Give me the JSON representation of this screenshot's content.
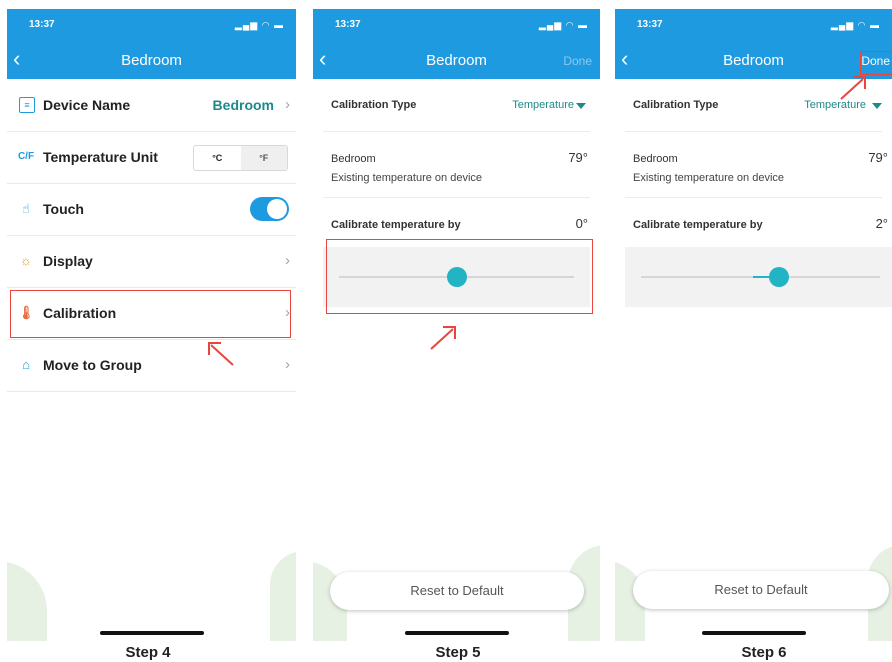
{
  "status": {
    "time": "13:37"
  },
  "navbar": {
    "title": "Bedroom",
    "done_label": "Done"
  },
  "step4": {
    "rows": [
      {
        "icon": "device-name-icon",
        "label": "Device Name",
        "value": "Bedroom"
      },
      {
        "icon": "temperature-unit-icon",
        "icon_text": "C/F",
        "label": "Temperature Unit",
        "options": [
          "°C",
          "°F"
        ]
      },
      {
        "icon": "touch-icon",
        "label": "Touch"
      },
      {
        "icon": "display-icon",
        "label": "Display"
      },
      {
        "icon": "thermometer-icon",
        "label": "Calibration"
      },
      {
        "icon": "group-icon",
        "label": "Move to Group"
      }
    ],
    "caption": "Step 4"
  },
  "step5": {
    "calibration_type_label": "Calibration Type",
    "calibration_type_value": "Temperature",
    "room_name": "Bedroom",
    "room_temp": "79°",
    "existing_label": "Existing temperature on device",
    "calibrate_label": "Calibrate temperature by",
    "calibrate_value": "0°",
    "reset_label": "Reset to Default",
    "caption": "Step 5"
  },
  "step6": {
    "calibration_type_label": "Calibration Type",
    "calibration_type_value": "Temperature",
    "room_name": "Bedroom",
    "room_temp": "79°",
    "existing_label": "Existing temperature on device",
    "calibrate_label": "Calibrate temperature by",
    "calibrate_value": "2°",
    "reset_label": "Reset to Default",
    "caption": "Step 6"
  },
  "colors": {
    "accent": "#1e9be0",
    "teal": "#22b3c4",
    "highlight": "#e8453c"
  }
}
